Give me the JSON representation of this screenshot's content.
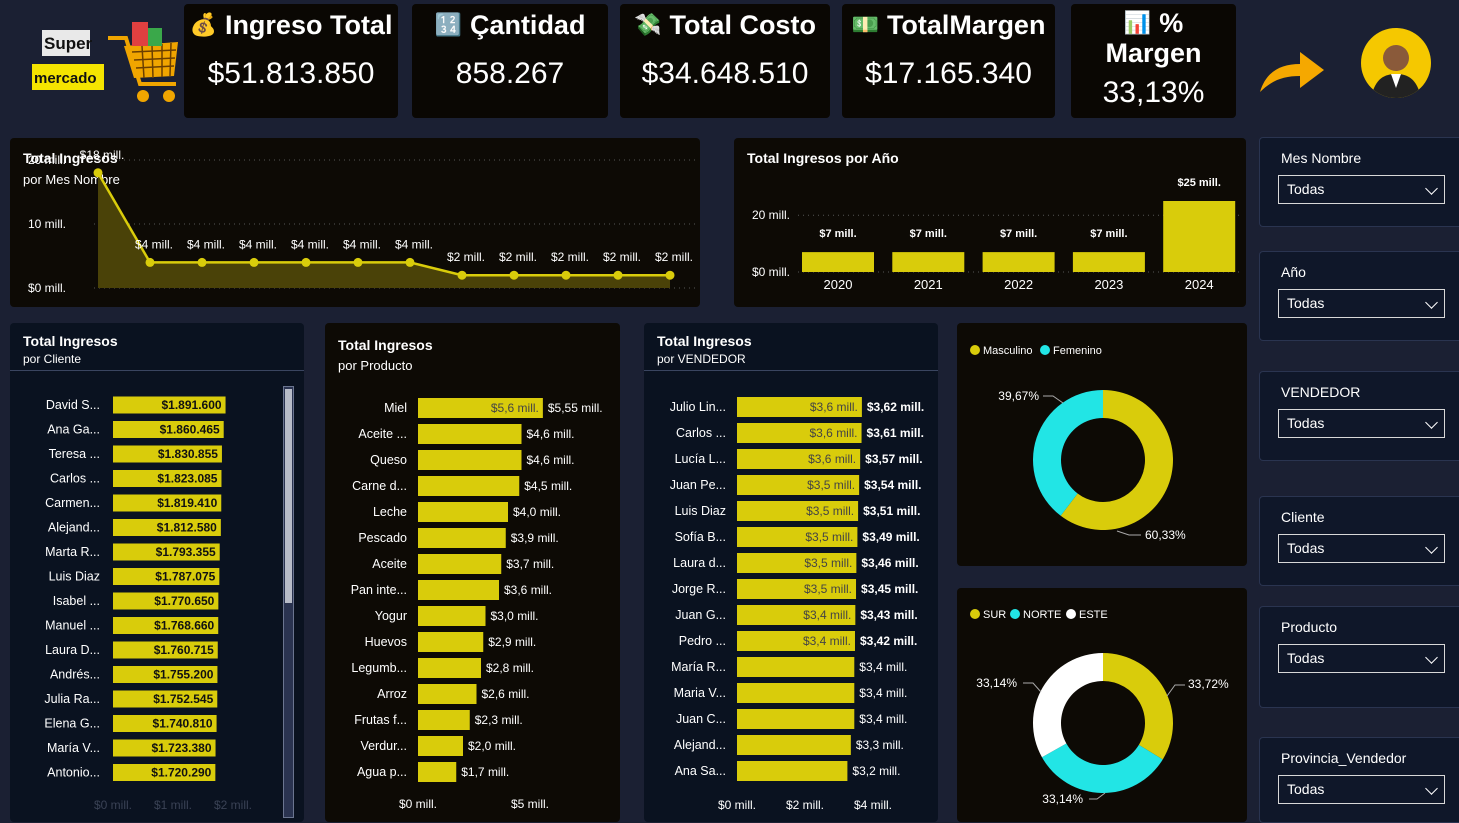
{
  "logo": {
    "word1": "Super",
    "word2": "mercado"
  },
  "kpis": [
    {
      "icon": "money-bag-icon",
      "glyph": "💰",
      "title": "Ingreso Total",
      "value": "$51.813.850"
    },
    {
      "icon": "numbers-icon",
      "glyph": "🔢",
      "title": "Çantidad",
      "value": "858.267"
    },
    {
      "icon": "flying-money-icon",
      "glyph": "💸",
      "title": "Total Costo",
      "value": "$34.648.510"
    },
    {
      "icon": "dollar-bill-icon",
      "glyph": "💵",
      "title": "TotalMargen",
      "value": "$17.165.340"
    },
    {
      "icon": "bar-chart-icon",
      "glyph": "📊",
      "title": "%",
      "title2": "Margen",
      "value": "33,13%"
    }
  ],
  "colors": {
    "accent": "#d9cc0b",
    "cyan": "#22e5e5",
    "white": "#ffffff",
    "bg": "#1b2033"
  },
  "chart_data": [
    {
      "type": "area",
      "title": "Total Ingresos",
      "subtitle": "por Mes Nombre",
      "y_ticks": [
        "20 mill.",
        "10 mill.",
        "$0 mill."
      ],
      "ylim": [
        0,
        20
      ],
      "values": [
        18,
        4,
        4,
        4,
        4,
        4,
        4,
        2,
        2,
        2,
        2,
        2
      ],
      "data_labels": [
        "$18 mill.",
        "$4 mill.",
        "$4 mill.",
        "$4 mill.",
        "$4 mill.",
        "$4 mill.",
        "$4 mill.",
        "$2 mill.",
        "$2 mill.",
        "$2 mill.",
        "$2 mill.",
        "$2 mill."
      ]
    },
    {
      "type": "bar",
      "title": "Total Ingresos por Año",
      "categories": [
        "2020",
        "2021",
        "2022",
        "2023",
        "2024"
      ],
      "values": [
        7,
        7,
        7,
        7,
        25
      ],
      "data_labels": [
        "$7 mill.",
        "$7 mill.",
        "$7 mill.",
        "$7 mill.",
        "$25 mill."
      ],
      "y_ticks": [
        "20 mill.",
        "$0 mill."
      ],
      "ylim": [
        0,
        25
      ]
    },
    {
      "type": "bar",
      "orientation": "horizontal",
      "title": "Total Ingresos",
      "subtitle": "por Cliente",
      "categories": [
        "David S...",
        "Ana Ga...",
        "Teresa ...",
        "Carlos ...",
        "Carmen...",
        "Alejand...",
        "Marta R...",
        "Luis Diaz",
        "Isabel ...",
        "Manuel ...",
        "Laura D...",
        "Andrés...",
        "Julia Ra...",
        "Elena G...",
        "María V...",
        "Antonio..."
      ],
      "values": [
        1891600,
        1860465,
        1830855,
        1823085,
        1819410,
        1812580,
        1793355,
        1787075,
        1770650,
        1768660,
        1760715,
        1755200,
        1752545,
        1740810,
        1723380,
        1720290
      ],
      "data_labels": [
        "$1.891.600",
        "$1.860.465",
        "$1.830.855",
        "$1.823.085",
        "$1.819.410",
        "$1.812.580",
        "$1.793.355",
        "$1.787.075",
        "$1.770.650",
        "$1.768.660",
        "$1.760.715",
        "$1.755.200",
        "$1.752.545",
        "$1.740.810",
        "$1.723.380",
        "$1.720.290"
      ],
      "x_ticks": [
        "$0 mill.",
        "$1 mill.",
        "$2 mill."
      ]
    },
    {
      "type": "bar",
      "orientation": "horizontal",
      "title": "Total Ingresos",
      "subtitle": "por Producto",
      "categories": [
        "Miel",
        "Aceite ...",
        "Queso",
        "Carne d...",
        "Leche",
        "Pescado",
        "Aceite",
        "Pan inte...",
        "Yogur",
        "Huevos",
        "Legumb...",
        "Arroz",
        "Frutas f...",
        "Verdur...",
        "Agua p..."
      ],
      "values": [
        5.55,
        4.6,
        4.6,
        4.5,
        4.0,
        3.9,
        3.7,
        3.6,
        3.0,
        2.9,
        2.8,
        2.6,
        2.3,
        2.0,
        1.7
      ],
      "data_labels": [
        "$5,55 mill.",
        "$4,6 mill.",
        "$4,6 mill.",
        "$4,5 mill.",
        "$4,0 mill.",
        "$3,9 mill.",
        "$3,7 mill.",
        "$3,6 mill.",
        "$3,0 mill.",
        "$2,9 mill.",
        "$2,8 mill.",
        "$2,6 mill.",
        "$2,3 mill.",
        "$2,0 mill.",
        "$1,7 mill."
      ],
      "inner_label": "$5,6 mill.",
      "x_ticks": [
        "$0 mill.",
        "$5 mill."
      ]
    },
    {
      "type": "bar",
      "orientation": "horizontal",
      "title": "Total Ingresos",
      "subtitle": "por VENDEDOR",
      "categories": [
        "Julio Lin...",
        "Carlos ...",
        "Lucía L...",
        "Juan Pe...",
        "Luis Diaz",
        "Sofía B...",
        "Laura d...",
        "Jorge R...",
        "Juan G...",
        "Pedro ...",
        "María R...",
        "Maria V...",
        "Juan C...",
        "Alejand...",
        "Ana Sa..."
      ],
      "values": [
        3.62,
        3.61,
        3.57,
        3.54,
        3.51,
        3.49,
        3.46,
        3.45,
        3.43,
        3.42,
        3.4,
        3.4,
        3.4,
        3.3,
        3.2
      ],
      "data_labels": [
        "$3,62 mill.",
        "$3,61 mill.",
        "$3,57 mill.",
        "$3,54 mill.",
        "$3,51 mill.",
        "$3,49 mill.",
        "$3,46 mill.",
        "$3,45 mill.",
        "$3,43 mill.",
        "$3,42 mill.",
        "$3,4 mill.",
        "$3,4 mill.",
        "$3,4 mill.",
        "$3,3 mill.",
        "$3,2 mill."
      ],
      "inner_labels": [
        "$3,6 mill.",
        "$3,6 mill.",
        "$3,6 mill.",
        "$3,5 mill.",
        "$3,5 mill.",
        "$3,5 mill.",
        "$3,5 mill.",
        "$3,5 mill.",
        "$3,4 mill.",
        "$3,4 mill."
      ],
      "x_ticks": [
        "$0 mill.",
        "$2 mill.",
        "$4 mill."
      ]
    },
    {
      "type": "pie",
      "variant": "donut",
      "legend": [
        "Masculino",
        "Femenino"
      ],
      "values": [
        60.33,
        39.67
      ],
      "data_labels": [
        "60,33%",
        "39,67%"
      ]
    },
    {
      "type": "pie",
      "variant": "donut",
      "legend": [
        "SUR",
        "NORTE",
        "ESTE"
      ],
      "values": [
        33.72,
        33.14,
        33.14
      ],
      "data_labels": [
        "33,72%",
        "33,14%",
        "33,14%"
      ]
    }
  ],
  "slicers": [
    {
      "label": "Mes Nombre",
      "value": "Todas"
    },
    {
      "label": "Año",
      "value": "Todas"
    },
    {
      "label": "VENDEDOR",
      "value": "Todas"
    },
    {
      "label": "Cliente",
      "value": "Todas"
    },
    {
      "label": "Producto",
      "value": "Todas"
    },
    {
      "label": "Provincia_Vendedor",
      "value": "Todas"
    }
  ]
}
